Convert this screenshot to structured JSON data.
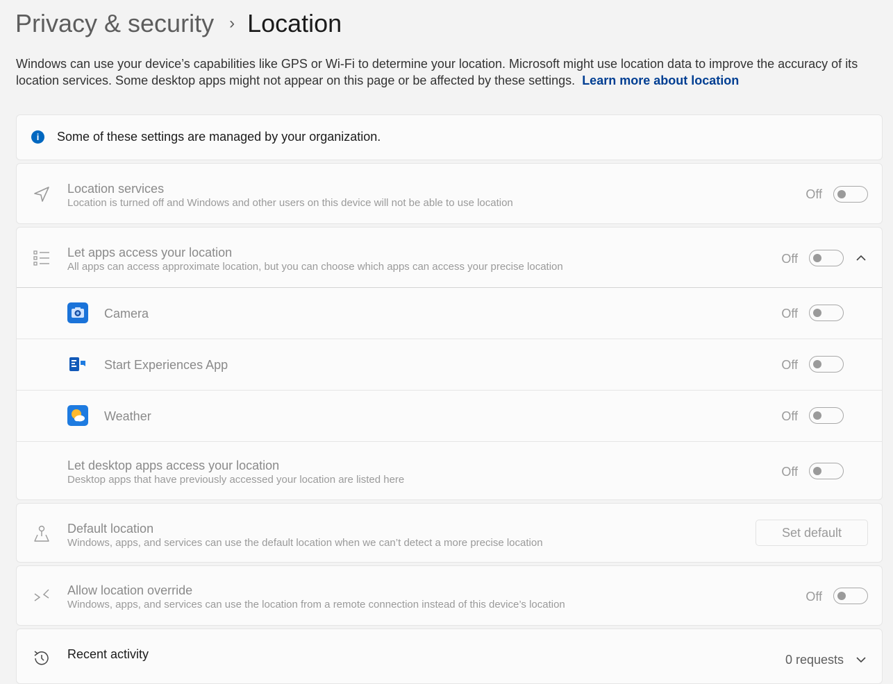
{
  "breadcrumb": {
    "parent": "Privacy & security",
    "separator": "›",
    "current": "Location"
  },
  "description": {
    "text": "Windows can use your device’s capabilities like GPS or Wi-Fi to determine your location. Microsoft might use location data to improve the accuracy of its location services. Some desktop apps might not appear on this page or be affected by these settings.",
    "link": "Learn more about location"
  },
  "banner": {
    "text": "Some of these settings are managed by your organization."
  },
  "location_services": {
    "title": "Location services",
    "subtitle": "Location is turned off and Windows and other users on this device will not be able to use location",
    "state": "Off"
  },
  "app_access": {
    "title": "Let apps access your location",
    "subtitle": "All apps can access approximate location, but you can choose which apps can access your precise location",
    "state": "Off",
    "apps": [
      {
        "name": "Camera",
        "state": "Off"
      },
      {
        "name": "Start Experiences App",
        "state": "Off"
      },
      {
        "name": "Weather",
        "state": "Off"
      }
    ],
    "desktop": {
      "title": "Let desktop apps access your location",
      "subtitle": "Desktop apps that have previously accessed your location are listed here",
      "state": "Off"
    }
  },
  "default_location": {
    "title": "Default location",
    "subtitle": "Windows, apps, and services can use the default location when we can’t detect a more precise location",
    "button": "Set default"
  },
  "override": {
    "title": "Allow location override",
    "subtitle": "Windows, apps, and services can use the location from a remote connection instead of this device’s location",
    "state": "Off"
  },
  "recent": {
    "title": "Recent activity",
    "count": "0 requests"
  },
  "colors": {
    "accent": "#0067c0",
    "link": "#003e92",
    "info": "#0067c0"
  }
}
